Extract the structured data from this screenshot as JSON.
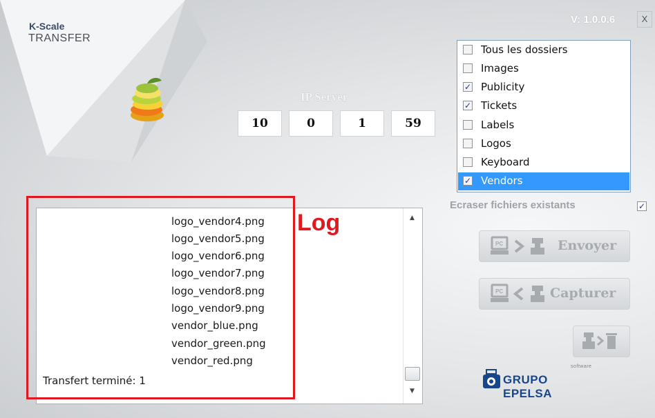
{
  "app": {
    "title_line1": "K-Scale",
    "title_line2": "TRANSFER",
    "version": "V: 1.0.0.6",
    "close_label": "X"
  },
  "ip": {
    "label": "IP Server",
    "octets": [
      "10",
      "0",
      "1",
      "59"
    ]
  },
  "folders": [
    {
      "label": "Tous les dossiers",
      "checked": false,
      "selected": false
    },
    {
      "label": "Images",
      "checked": false,
      "selected": false
    },
    {
      "label": "Publicity",
      "checked": true,
      "selected": false
    },
    {
      "label": "Tickets",
      "checked": true,
      "selected": false
    },
    {
      "label": "Labels",
      "checked": false,
      "selected": false
    },
    {
      "label": "Logos",
      "checked": false,
      "selected": false
    },
    {
      "label": "Keyboard",
      "checked": false,
      "selected": false
    },
    {
      "label": "Vendors",
      "checked": true,
      "selected": true
    }
  ],
  "overwrite": {
    "label": "Ecraser fichiers existants",
    "checked": true
  },
  "buttons": {
    "send": "Envoyer",
    "capture": "Capturer",
    "delete_icon": "delete-icon"
  },
  "log": {
    "lines": [
      "logo_vendor4.png",
      "logo_vendor5.png",
      "logo_vendor6.png",
      "logo_vendor7.png",
      "logo_vendor8.png",
      "logo_vendor9.png",
      "vendor_blue.png",
      "vendor_green.png",
      "vendor_red.png"
    ],
    "status": "Transfert terminé: 1"
  },
  "annotation": {
    "label": "Log",
    "color": "#e0181f"
  },
  "brand": {
    "software": "software",
    "name": "GRUPO EPELSA",
    "color": "#17468c"
  },
  "colors": {
    "selection": "#3399ff",
    "checkmark": "#21398c"
  }
}
